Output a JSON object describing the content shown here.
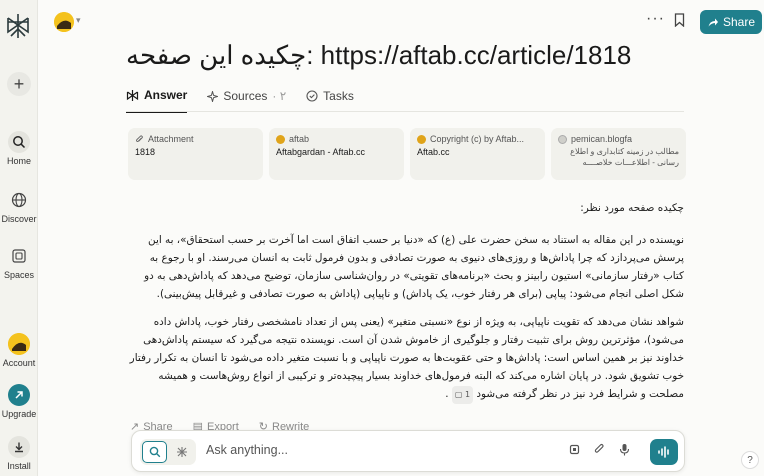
{
  "sidebar": {
    "items": [
      {
        "label": "Home",
        "icon": "search-icon"
      },
      {
        "label": "Discover",
        "icon": "globe-icon"
      },
      {
        "label": "Spaces",
        "icon": "spaces-icon"
      },
      {
        "label": "Account",
        "icon": "avatar-icon"
      },
      {
        "label": "Upgrade",
        "icon": "arrow-up-right-icon"
      },
      {
        "label": "Install",
        "icon": "download-icon"
      }
    ],
    "new_thread_icon": "+"
  },
  "topbar": {
    "more_label": "···",
    "share_label": "Share"
  },
  "page": {
    "title": "چکیده این صفحه: https://aftab.cc/article/1818"
  },
  "tabs": [
    {
      "label": "Answer",
      "icon": "answer-icon"
    },
    {
      "label": "Sources",
      "count": "· ۲",
      "icon": "sources-icon"
    },
    {
      "label": "Tasks",
      "icon": "tasks-icon"
    }
  ],
  "sources": [
    {
      "source": "Attachment",
      "title": "1818"
    },
    {
      "source": "aftab",
      "title": "Aftabgardan - Aftab.cc"
    },
    {
      "source": "Copyright (c) by Aftab...",
      "title": "Aftab.cc"
    },
    {
      "source": "pemican.blogfa",
      "title": "مطالب در زمینه کتابداری و اطلاع رسانی - اطلاعـــات خلاصــــه"
    }
  ],
  "answer": {
    "heading": "چکیده صفحه مورد نظر:",
    "paragraph1": "نویسنده در این مقاله به استناد به سخن حضرت علی (ع) که «دنیا بر حسب اتفاق است اما آخرت بر حسب استحقاق»، به این پرسش می‌پردازد که چرا پاداش‌ها و روزی‌های دنیوی به صورت تصادفی و بدون فرمول ثابت به انسان می‌رسند. او با رجوع به کتاب «رفتار سازمانی» استیون رابینز و بحث «برنامه‌های تقویتی» در روان‌شناسی سازمان، توضیح می‌دهد که پاداش‌دهی به دو شکل اصلی انجام می‌شود: پیاپی (برای هر رفتار خوب، یک پاداش) و ناپیاپی (پاداش به صورت تصادفی و غیرقابل پیش‌بینی).",
    "paragraph2": "شواهد نشان می‌دهد که تقویت ناپیاپی، به ویژه از نوع «نسبتی متغیر» (یعنی پس از تعداد نامشخصی رفتار خوب، پاداش داده می‌شود)، مؤثرترین روش برای تثبیت رفتار و جلوگیری از خاموش شدن آن است. نویسنده نتیجه می‌گیرد که سیستم پاداش‌دهی خداوند نیز بر همین اساس است: پاداش‌ها و حتی عقوبت‌ها به صورت ناپیاپی و با نسبت متغیر داده می‌شود تا انسان به تکرار رفتار خوب تشویق شود. در پایان اشاره می‌کند که البته فرمول‌های خداوند بسیار پیچیده‌تر و ترکیبی از انواع روش‌هاست و همیشه مصلحت و شرایط فرد نیز در نظر گرفته می‌شود",
    "citation": "1"
  },
  "actions": {
    "share": "Share",
    "export": "Export",
    "rewrite": "Rewrite"
  },
  "composer": {
    "placeholder": "Ask anything..."
  },
  "help_label": "?",
  "colors": {
    "accent": "#20808d",
    "sidebar_bg": "#f3f3ee",
    "card_bg": "#f1f1ec"
  }
}
